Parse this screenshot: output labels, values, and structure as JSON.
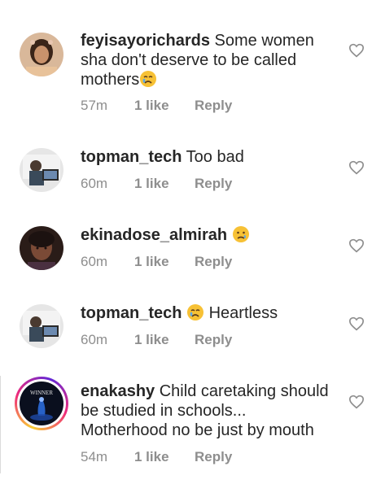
{
  "comments": [
    {
      "username": "feyisayorichards",
      "text": "Some women sha don't deserve to be called mothers",
      "emoji": "crying-face",
      "time": "57m",
      "likes": "1 like",
      "reply": "Reply"
    },
    {
      "username": "topman_tech",
      "text": "Too bad",
      "emoji": "",
      "time": "60m",
      "likes": "1 like",
      "reply": "Reply"
    },
    {
      "username": "ekinadose_almirah",
      "text": "",
      "emoji": "sad-face",
      "time": "60m",
      "likes": "1 like",
      "reply": "Reply"
    },
    {
      "username": "topman_tech",
      "text": "Heartless",
      "emoji": "crying-face",
      "time": "60m",
      "likes": "1 like",
      "reply": "Reply"
    },
    {
      "username": "enakashy",
      "text": "Child caretaking should be studied in schools... Motherhood no be just by mouth",
      "emoji": "",
      "time": "54m",
      "likes": "1 like",
      "reply": "Reply",
      "avatar_text": "WINNER"
    }
  ],
  "colors": {
    "text": "#262626",
    "meta": "#8e8e8e",
    "story_ring": [
      "#f9ce34",
      "#ee2a7b",
      "#6228d7"
    ]
  }
}
